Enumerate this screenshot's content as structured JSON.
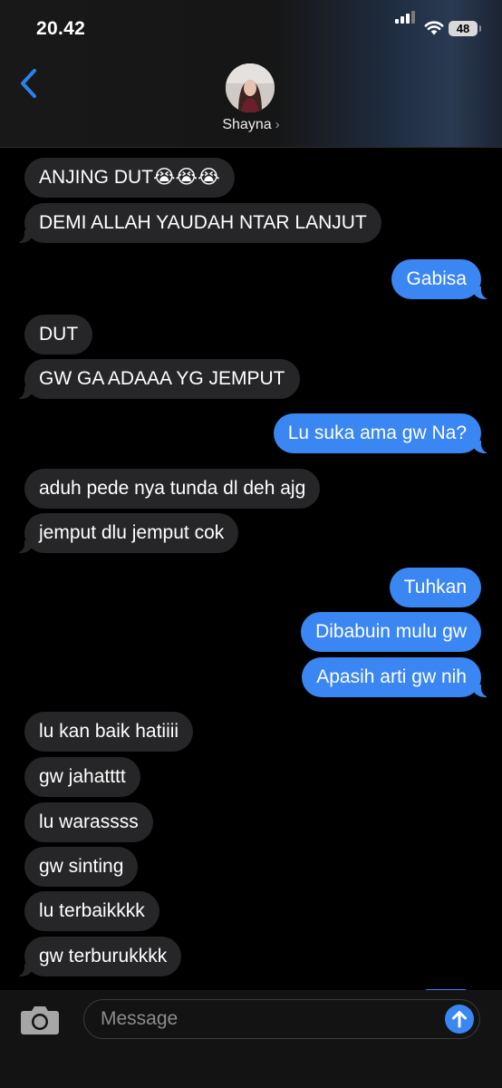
{
  "status_bar": {
    "time": "20.42",
    "battery": "48"
  },
  "header": {
    "contact_name": "Shayna",
    "contact_chevron": "›",
    "back_icon": "chevron-left-icon"
  },
  "messages": [
    {
      "dir": "in",
      "text": "ANJING DUT😭😭😭"
    },
    {
      "dir": "in",
      "text": "DEMI ALLAH YAUDAH NTAR LANJUT"
    },
    {
      "dir": "out",
      "text": "Gabisa"
    },
    {
      "dir": "in",
      "text": "DUT"
    },
    {
      "dir": "in",
      "text": "GW GA ADAAA YG JEMPUT"
    },
    {
      "dir": "out",
      "text": "Lu suka ama gw Na?"
    },
    {
      "dir": "in",
      "text": "aduh pede nya tunda dl deh ajg"
    },
    {
      "dir": "in",
      "text": "jemput dlu jemput cok"
    },
    {
      "dir": "out",
      "text": "Tuhkan"
    },
    {
      "dir": "out",
      "text": "Dibabuin mulu gw"
    },
    {
      "dir": "out",
      "text": "Apasih arti gw nih"
    },
    {
      "dir": "in",
      "text": "lu kan baik hatiiii"
    },
    {
      "dir": "in",
      "text": "gw jahatttt"
    },
    {
      "dir": "in",
      "text": "lu warassss"
    },
    {
      "dir": "in",
      "text": "gw sinting"
    },
    {
      "dir": "in",
      "text": "lu terbaikkkk"
    },
    {
      "dir": "in",
      "text": "gw terburukkkk"
    }
  ],
  "input": {
    "placeholder": "Message",
    "camera_icon": "camera-icon",
    "send_icon": "send-arrow-icon"
  },
  "colors": {
    "outgoing": "#3a86f2",
    "incoming": "#262628",
    "background": "#000000",
    "accent": "#2f80ed"
  }
}
